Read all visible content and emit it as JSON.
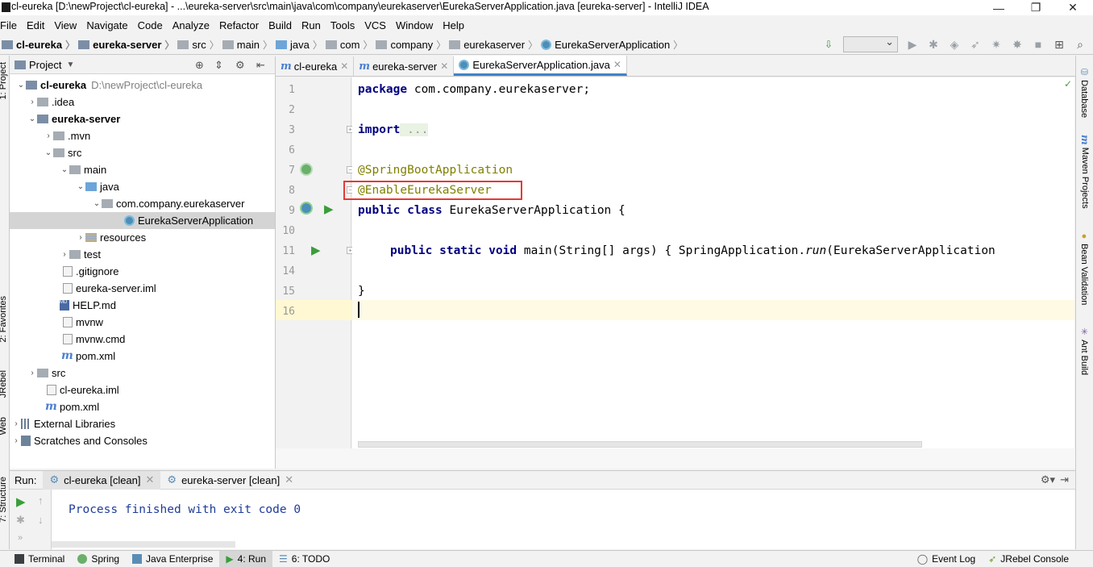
{
  "window": {
    "title": "cl-eureka [D:\\newProject\\cl-eureka] - ...\\eureka-server\\src\\main\\java\\com\\company\\eurekaserver\\EurekaServerApplication.java [eureka-server] - IntelliJ IDEA",
    "minimize": "—",
    "maximize": "❐",
    "close": "✕"
  },
  "menu": [
    "File",
    "Edit",
    "View",
    "Navigate",
    "Code",
    "Analyze",
    "Refactor",
    "Build",
    "Run",
    "Tools",
    "VCS",
    "Window",
    "Help"
  ],
  "breadcrumbs": [
    "cl-eureka",
    "eureka-server",
    "src",
    "main",
    "java",
    "com",
    "company",
    "eurekaserver",
    "EurekaServerApplication"
  ],
  "left_strip": {
    "project": "1: Project",
    "favorites": "2: Favorites",
    "jrebel": "JRebel",
    "web": "Web",
    "structure": "7: Structure"
  },
  "project_panel": {
    "header": "Project",
    "tree": [
      {
        "label": "cl-eureka",
        "suffix": "D:\\newProject\\cl-eureka",
        "bold": true
      },
      {
        "label": ".idea"
      },
      {
        "label": "eureka-server",
        "bold": true
      },
      {
        "label": ".mvn"
      },
      {
        "label": "src"
      },
      {
        "label": "main"
      },
      {
        "label": "java"
      },
      {
        "label": "com.company.eurekaserver"
      },
      {
        "label": "EurekaServerApplication",
        "selected": true
      },
      {
        "label": "resources"
      },
      {
        "label": "test"
      },
      {
        "label": ".gitignore"
      },
      {
        "label": "eureka-server.iml"
      },
      {
        "label": "HELP.md"
      },
      {
        "label": "mvnw"
      },
      {
        "label": "mvnw.cmd"
      },
      {
        "label": "pom.xml"
      },
      {
        "label": "src"
      },
      {
        "label": "cl-eureka.iml"
      },
      {
        "label": "pom.xml"
      },
      {
        "label": "External Libraries"
      },
      {
        "label": "Scratches and Consoles"
      }
    ]
  },
  "editor": {
    "tabs": [
      "cl-eureka",
      "eureka-server",
      "EurekaServerApplication.java"
    ],
    "line_numbers": [
      "1",
      "2",
      "3",
      "6",
      "7",
      "8",
      "9",
      "10",
      "11",
      "14",
      "15",
      "16"
    ],
    "code": {
      "l1_kw": "package",
      "l1_rest": " com.company.eurekaserver;",
      "l3_kw": "import",
      "l3_rest": " ...",
      "l7": "@SpringBootApplication",
      "l8": "@EnableEurekaServer",
      "l9_kw": "public class",
      "l9_rest": " EurekaServerApplication {",
      "l11_kw": "public static void",
      "l11_mid": " main(String[] args) { SpringApplication.",
      "l11_it": "run",
      "l11_end": "(EurekaServerApplication",
      "l15": "}"
    }
  },
  "right_strip": [
    "Database",
    "Maven Projects",
    "Bean Validation",
    "Ant Build"
  ],
  "run_panel": {
    "label": "Run:",
    "tabs": [
      "cl-eureka [clean]",
      "eureka-server [clean]"
    ],
    "output": "Process finished with exit code 0"
  },
  "status_bar": {
    "items": [
      "Terminal",
      "Spring",
      "Java Enterprise",
      "4: Run",
      "6: TODO"
    ],
    "right": [
      "Event Log",
      "JRebel Console"
    ]
  },
  "colors": {
    "keyword": "#000080",
    "annotation": "#808000",
    "console": "#1f3c99",
    "highlight_box": "#e53935"
  }
}
